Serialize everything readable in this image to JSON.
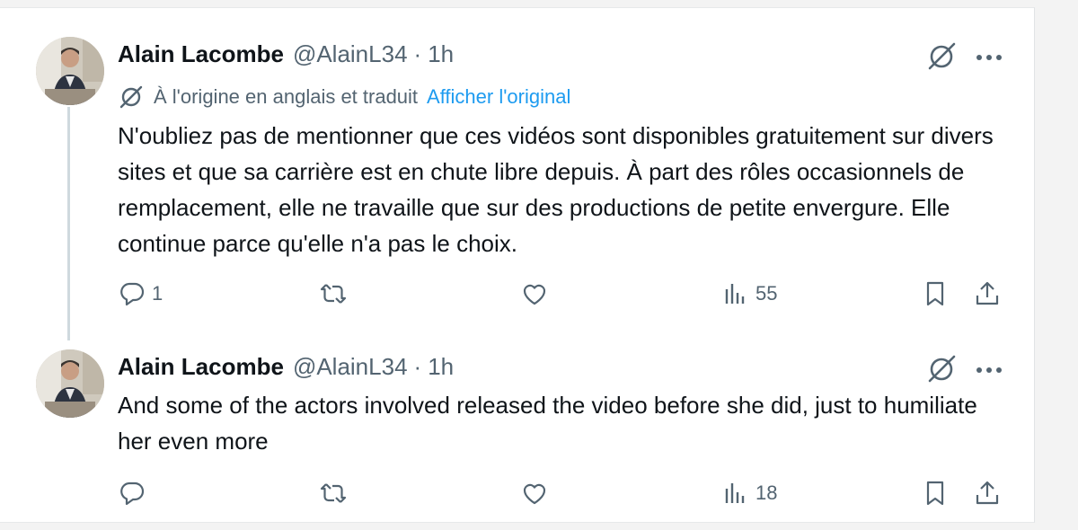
{
  "tweets": [
    {
      "author": "Alain Lacombe",
      "handle": "@AlainL34",
      "separator": "·",
      "time": "1h",
      "translation_note": "À l'origine en anglais et traduit",
      "show_original_label": "Afficher l'original",
      "text": "N'oubliez pas de mentionner que ces vidéos sont disponibles gratuitement sur divers sites et que sa carrière est en chute libre depuis. À part des rôles occasionnels de remplacement, elle ne travaille que sur des productions de petite envergure. Elle continue parce qu'elle n'a pas le choix.",
      "reply_count": "1",
      "retweet_count": "",
      "like_count": "",
      "view_count": "55"
    },
    {
      "author": "Alain Lacombe",
      "handle": "@AlainL34",
      "separator": "·",
      "time": "1h",
      "text": "And some of the actors involved released the video before she did, just to humiliate her even more",
      "reply_count": "",
      "retweet_count": "",
      "like_count": "",
      "view_count": "18"
    }
  ],
  "icons": {
    "translate": "grok-translate-icon",
    "more": "more-dots-icon",
    "reply": "reply-bubble-icon",
    "retweet": "retweet-icon",
    "like": "heart-icon",
    "views": "views-bar-chart-icon",
    "bookmark": "bookmark-icon",
    "share": "share-upload-icon"
  },
  "colors": {
    "text": "#0f1419",
    "secondary": "#536471",
    "link": "#1d9bf0",
    "thread_line": "#cfd9de"
  }
}
